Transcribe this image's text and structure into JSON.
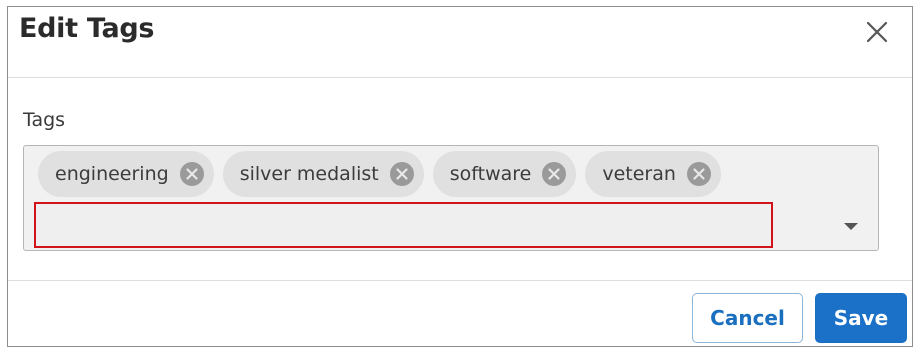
{
  "dialog": {
    "title": "Edit Tags",
    "close_icon": "close-icon"
  },
  "field": {
    "label": "Tags",
    "input_value": "",
    "dropdown_icon": "caret-down-icon"
  },
  "tags": [
    {
      "label": "engineering",
      "remove_icon": "remove-circle-icon"
    },
    {
      "label": "silver medalist",
      "remove_icon": "remove-circle-icon"
    },
    {
      "label": "software",
      "remove_icon": "remove-circle-icon"
    },
    {
      "label": "veteran",
      "remove_icon": "remove-circle-icon"
    }
  ],
  "footer": {
    "cancel_label": "Cancel",
    "save_label": "Save"
  },
  "colors": {
    "primary": "#1b70c8",
    "focus_border": "#d0141a",
    "chip_bg": "#e0e0e0"
  }
}
